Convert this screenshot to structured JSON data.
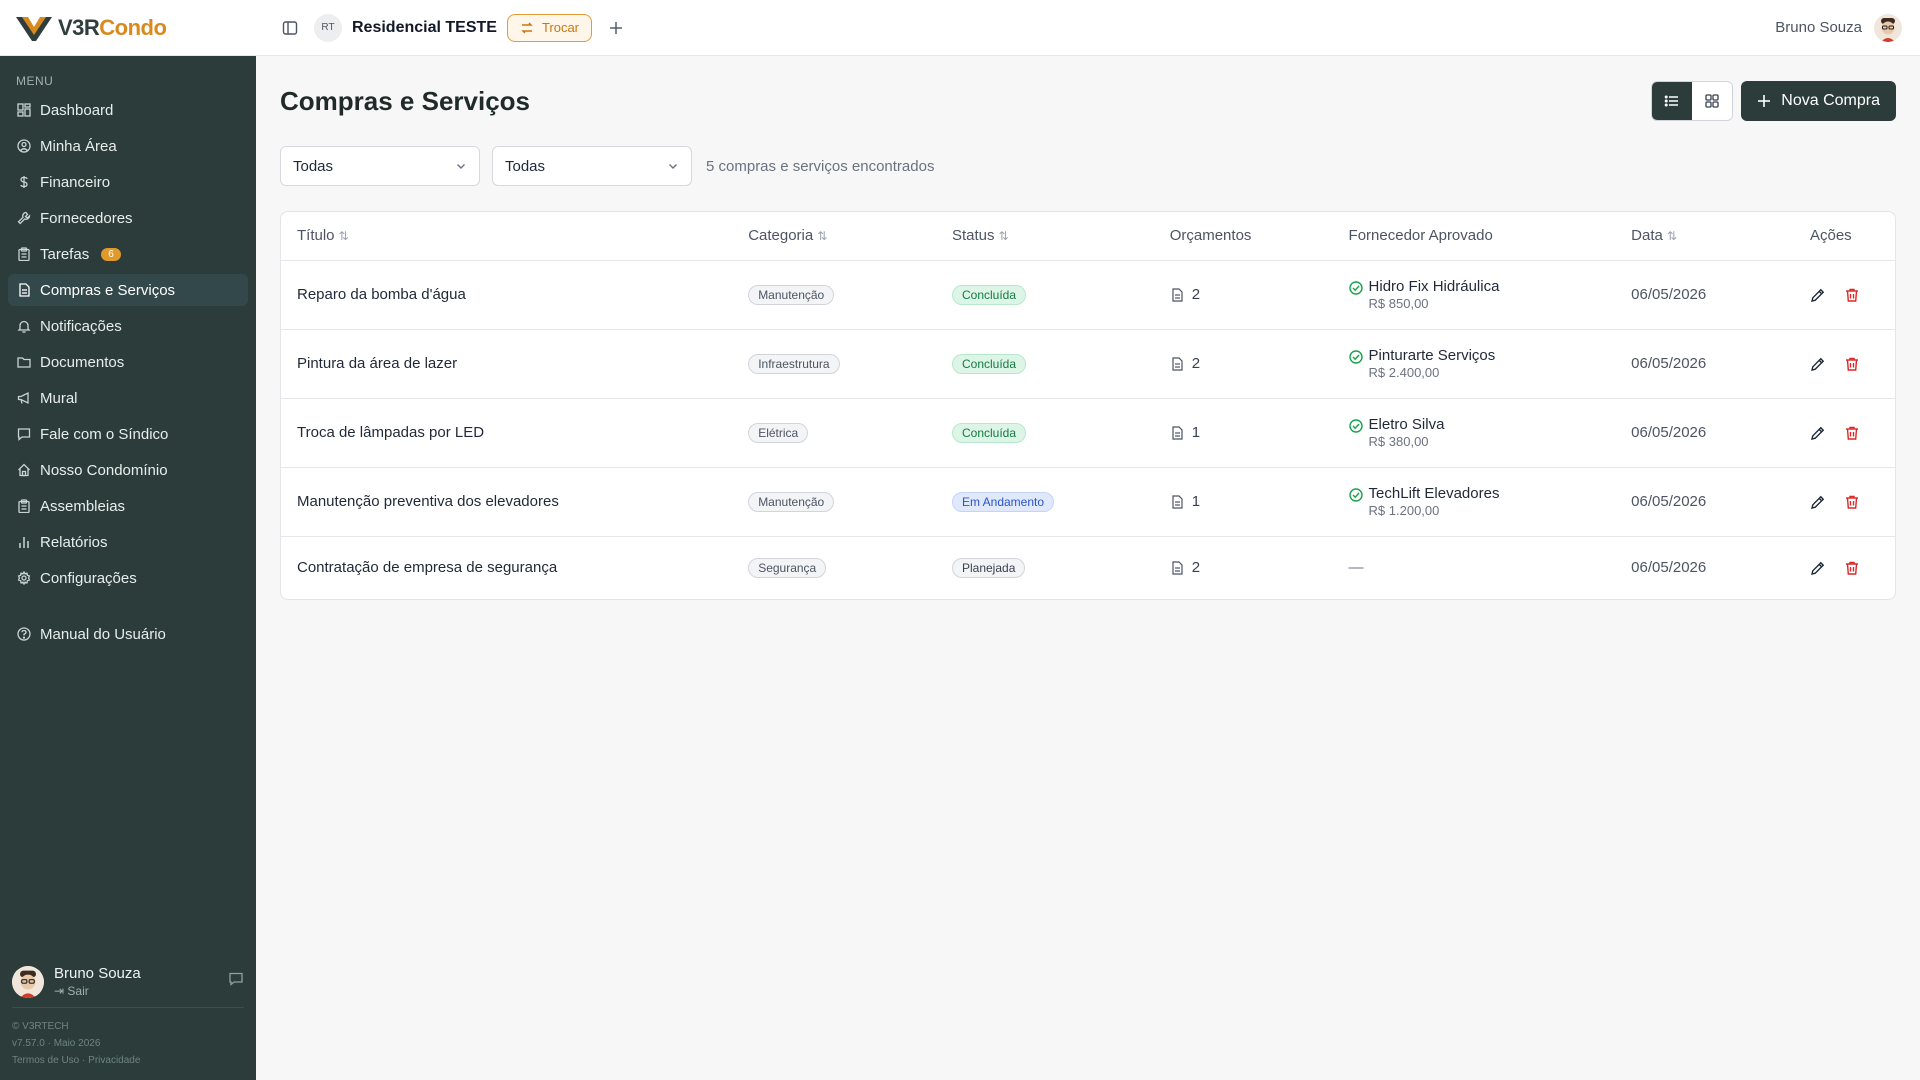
{
  "brand": {
    "logo_v3r": "V3R",
    "logo_condo": "Condo",
    "accent": "#d98a1e",
    "sidebar_bg": "#2b3c3a"
  },
  "header": {
    "condo_initials": "RT",
    "condo_name": "Residencial TESTE",
    "switch_label": "Trocar",
    "user_name": "Bruno Souza"
  },
  "sidebar": {
    "menu_label": "MENU",
    "items": [
      {
        "label": "Dashboard",
        "icon": "dashboard-icon"
      },
      {
        "label": "Minha Área",
        "icon": "user-circle-icon"
      },
      {
        "label": "Financeiro",
        "icon": "dollar-icon"
      },
      {
        "label": "Fornecedores",
        "icon": "wrench-icon"
      },
      {
        "label": "Tarefas",
        "icon": "clipboard-icon",
        "badge": "6"
      },
      {
        "label": "Compras e Serviços",
        "icon": "file-icon",
        "active": true
      },
      {
        "label": "Notificações",
        "icon": "bell-icon"
      },
      {
        "label": "Documentos",
        "icon": "folder-icon"
      },
      {
        "label": "Mural",
        "icon": "megaphone-icon"
      },
      {
        "label": "Fale com o Síndico",
        "icon": "chat-icon"
      },
      {
        "label": "Nosso Condomínio",
        "icon": "home-icon"
      },
      {
        "label": "Assembleias",
        "icon": "clipboard-icon"
      },
      {
        "label": "Relatórios",
        "icon": "bar-chart-icon"
      },
      {
        "label": "Configurações",
        "icon": "gear-icon"
      }
    ],
    "manual_label": "Manual do Usuário",
    "user_name": "Bruno Souza",
    "logout_label": "Sair",
    "footer_copyright": "© V3RTECH",
    "footer_version": "v7.57.0 · Maio 2026",
    "footer_terms": "Termos de Uso",
    "footer_sep": "·",
    "footer_privacy": "Privacidade"
  },
  "main": {
    "title": "Compras e Serviços",
    "new_button": "Nova Compra",
    "filter_category": "Todas",
    "filter_status": "Todas",
    "result_count": "5 compras e serviços encontrados",
    "columns": [
      "Título",
      "Categoria",
      "Status",
      "Orçamentos",
      "Fornecedor Aprovado",
      "Data",
      "Ações"
    ],
    "rows": [
      {
        "title": "Reparo da bomba d'água",
        "category": "Manutenção",
        "status": "Concluída",
        "status_kind": "done",
        "quotes": "2",
        "supplier": "Hidro Fix Hidráulica",
        "amount": "R$ 850,00",
        "date": "06/05/2026"
      },
      {
        "title": "Pintura da área de lazer",
        "category": "Infraestrutura",
        "status": "Concluída",
        "status_kind": "done",
        "quotes": "2",
        "supplier": "Pinturarte Serviços",
        "amount": "R$ 2.400,00",
        "date": "06/05/2026"
      },
      {
        "title": "Troca de lâmpadas por LED",
        "category": "Elétrica",
        "status": "Concluída",
        "status_kind": "done",
        "quotes": "1",
        "supplier": "Eletro Silva",
        "amount": "R$ 380,00",
        "date": "06/05/2026"
      },
      {
        "title": "Manutenção preventiva dos elevadores",
        "category": "Manutenção",
        "status": "Em Andamento",
        "status_kind": "prog",
        "quotes": "1",
        "supplier": "TechLift Elevadores",
        "amount": "R$ 1.200,00",
        "date": "06/05/2026"
      },
      {
        "title": "Contratação de empresa de segurança",
        "category": "Segurança",
        "status": "Planejada",
        "status_kind": "plan",
        "quotes": "2",
        "supplier": "",
        "supplier_placeholder": "—",
        "amount": "",
        "date": "06/05/2026"
      }
    ]
  }
}
